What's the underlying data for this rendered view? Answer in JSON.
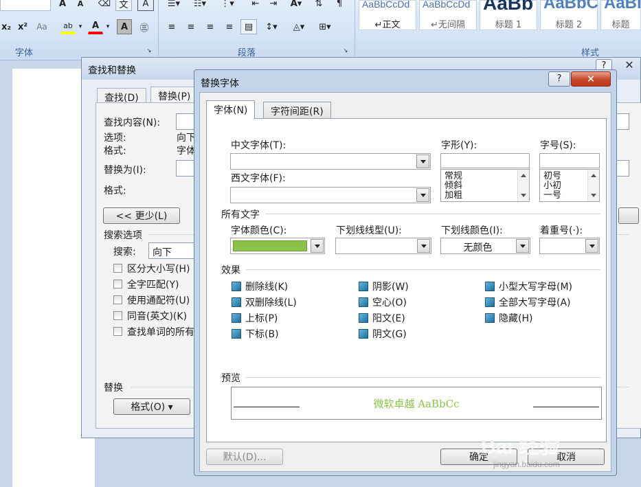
{
  "ribbon": {
    "group_font": "字体",
    "group_paragraph": "段落",
    "group_styles": "样式",
    "subscript": "x₂",
    "superscript": "x²",
    "change_case": "Aa",
    "highlight": "ab",
    "font_color_label": "A",
    "char_shading": "A",
    "enclose": "㊂",
    "grow_font": "A",
    "shrink_font": "A",
    "styles": [
      {
        "sample": "AaBbCcDd",
        "name": "↵正文"
      },
      {
        "sample": "AaBbCcDd",
        "name": "↵无间隔"
      },
      {
        "sample": "AaBb",
        "name": "标题 1"
      },
      {
        "sample": "AaBbC",
        "name": "标题 2"
      },
      {
        "sample": "AaBl",
        "name": "标题"
      }
    ],
    "colors": {
      "highlight": "#ffff00",
      "font_color": "#ff0000"
    }
  },
  "find_replace": {
    "title": "查找和替换",
    "help": "?",
    "close": "✕",
    "tabs": [
      "查找(D)",
      "替换(P)"
    ],
    "find_what_label": "查找内容(N):",
    "options_label": "选项:",
    "options_value": "向下",
    "format_label": "格式:",
    "format_value": "字体",
    "replace_with_label": "替换为(I):",
    "format_label2": "格式:",
    "less_button": "<< 更少(L)",
    "search_options": "搜索选项",
    "search_label": "搜索:",
    "search_value": "向下",
    "checkboxes": [
      "区分大小写(H)",
      "全字匹配(Y)",
      "使用通配符(U)",
      "同音(英文)(K)",
      "查找单词的所有"
    ],
    "replace_section": "替换",
    "format_button": "格式(O) ▾"
  },
  "replace_font": {
    "title": "替换字体",
    "help": "?",
    "close": "✕",
    "tabs": [
      "字体(N)",
      "字符间距(R)"
    ],
    "cn_font_label": "中文字体(T):",
    "west_font_label": "西文字体(F):",
    "style_label": "字形(Y):",
    "style_items": [
      "常规",
      "倾斜",
      "加粗"
    ],
    "size_label": "字号(S):",
    "size_items": [
      "初号",
      "小初",
      "一号"
    ],
    "all_text": "所有文字",
    "font_color_label": "字体颜色(C):",
    "font_color_value": "#8bc34a",
    "underline_style_label": "下划线线型(U):",
    "underline_color_label": "下划线颜色(I):",
    "underline_color_value": "无颜色",
    "emphasis_label": "着重号(·):",
    "effects": "效果",
    "effects_items": [
      [
        "删除线(K)",
        "阴影(W)",
        "小型大写字母(M)"
      ],
      [
        "双删除线(L)",
        "空心(O)",
        "全部大写字母(A)"
      ],
      [
        "上标(P)",
        "阳文(E)",
        "隐藏(H)"
      ],
      [
        "下标(B)",
        "阴文(G)"
      ]
    ],
    "preview": "预览",
    "preview_text": "微软卓越  AaBbCc",
    "default_button": "默认(D)...",
    "ok_button": "确定",
    "cancel_button": "取消"
  },
  "watermark": {
    "logo": "Bai 经验",
    "url": "jingyan.baidu.com"
  }
}
